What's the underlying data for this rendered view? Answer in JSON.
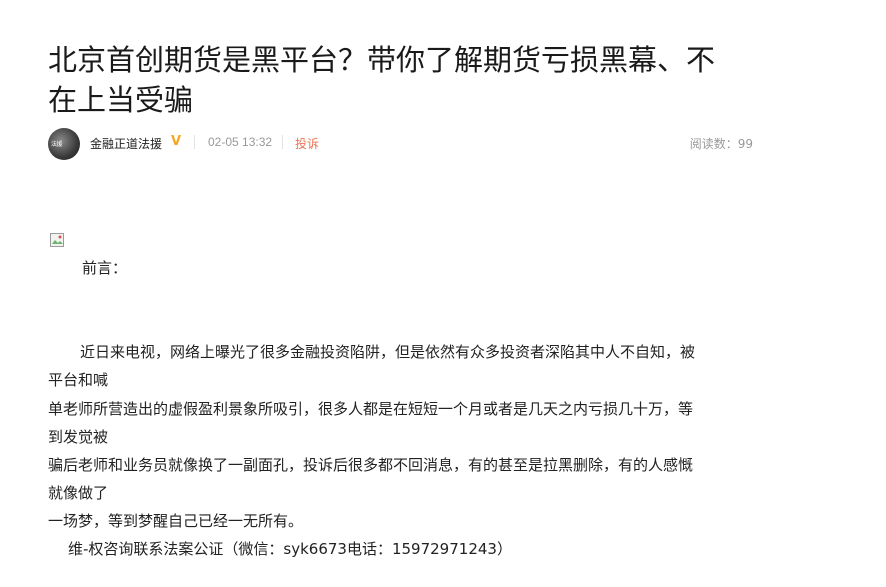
{
  "article": {
    "title_line1": "北京首创期货是黑平台？带你了解期货亏损黑幕、不",
    "title_line2": "在上当受骗"
  },
  "meta": {
    "avatar_text": "法援",
    "author": "金融正道法援",
    "vip_icon": "V",
    "date": "02-05 13:32",
    "complain_label": "投诉",
    "read_count": "阅读数：99"
  },
  "body": {
    "preface": "前言：",
    "lines": [
      "近日来电视，网络上曝光了很多金融投资陷阱，但是依然有众多投资者深陷其中人不自知，被",
      "平台和喊",
      "单老师所营造出的虚假盈利景象所吸引，很多人都是在短短一个月或者是几天之内亏损几十万，等",
      "到发觉被",
      "骗后老师和业务员就像换了一副面孔，投诉后很多都不回消息，有的甚至是拉黑删除，有的人感慨",
      "就像做了",
      "一场梦，等到梦醒自己已经一无所有。",
      "维-权咨询联系法案公证（微信：syk6673电话：15972971243）"
    ]
  },
  "colors": {
    "title": "#1a1a1a",
    "complain": "#eb7350",
    "vip": "#f5a623",
    "meta_gray": "#999999"
  },
  "icons": {
    "broken_image": "broken-image-icon",
    "vip": "vip-badge-icon"
  }
}
